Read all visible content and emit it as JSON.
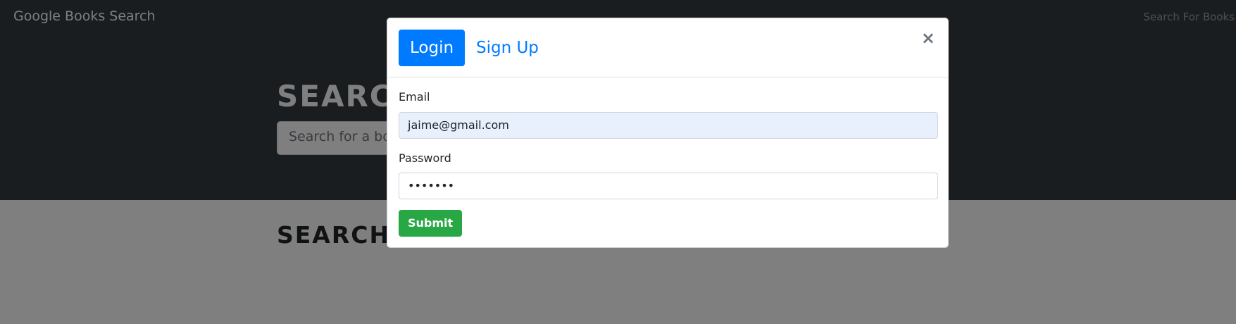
{
  "navbar": {
    "brand": "Google Books Search",
    "link": "Search For Books"
  },
  "hero": {
    "title": "SEARCH FOR BOOKS!",
    "search_placeholder": "Search for a book"
  },
  "results": {
    "title": "SEARCH FOR A BOOK TO BEGIN"
  },
  "modal": {
    "tabs": [
      {
        "label": "Login",
        "active": true
      },
      {
        "label": "Sign Up",
        "active": false
      }
    ],
    "close": "×",
    "email_label": "Email",
    "email_value": "jaime@gmail.com",
    "password_label": "Password",
    "password_value": "•••••••",
    "submit_label": "Submit"
  },
  "colors": {
    "dark": "#343a40",
    "primary": "#007bff",
    "success": "#28a745"
  }
}
